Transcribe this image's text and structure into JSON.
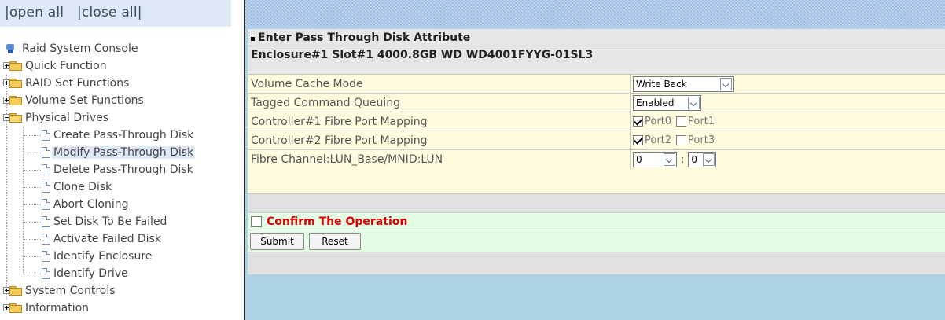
{
  "left": {
    "open_all": "|open all",
    "close_all": "|close all|",
    "tree": {
      "root": "Raid System Console",
      "quick_function": "Quick Function",
      "raid_set_functions": "RAID Set Functions",
      "volume_set_functions": "Volume Set Functions",
      "physical_drives": "Physical Drives",
      "physical_children": [
        "Create Pass-Through Disk",
        "Modify Pass-Through Disk",
        "Delete Pass-Through Disk",
        "Clone Disk",
        "Abort Cloning",
        "Set Disk To Be Failed",
        "Activate Failed Disk",
        "Identify Enclosure",
        "Identify Drive"
      ],
      "system_controls": "System Controls",
      "information": "Information",
      "selected": "Modify Pass-Through Disk"
    }
  },
  "form": {
    "section_title": "Enter Pass Through Disk Attribute",
    "disk_info": "Enclosure#1 Slot#1 4000.8GB WD WD4001FYYG-01SL3",
    "rows": {
      "cache_mode": {
        "label": "Volume Cache Mode",
        "value": "Write Back"
      },
      "tcq": {
        "label": "Tagged Command Queuing",
        "value": "Enabled"
      },
      "ctrl1": {
        "label": "Controller#1 Fibre Port Mapping",
        "port_a": "Port0",
        "port_a_checked": true,
        "port_b": "Port1",
        "port_b_checked": false
      },
      "ctrl2": {
        "label": "Controller#2 Fibre Port Mapping",
        "port_a": "Port2",
        "port_a_checked": true,
        "port_b": "Port3",
        "port_b_checked": false
      },
      "lun": {
        "label": "Fibre Channel:LUN_Base/MNID:LUN",
        "base": "0",
        "separator": ":",
        "lun": "0"
      }
    },
    "confirm_label": "Confirm The Operation",
    "confirm_checked": false,
    "submit_label": "Submit",
    "reset_label": "Reset"
  },
  "colors": {
    "confirm_text": "#e00000",
    "right_frame_bg": "#add2e4",
    "selected_item_bg": "#dfe8f6"
  }
}
